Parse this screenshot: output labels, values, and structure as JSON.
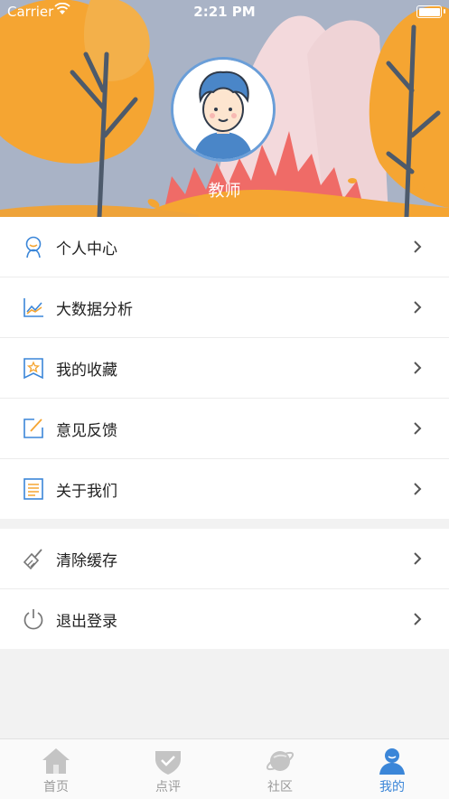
{
  "status_bar": {
    "carrier": "Carrier",
    "time": "2:21 PM"
  },
  "profile": {
    "role": "教师"
  },
  "menu_primary": [
    {
      "label": "个人中心",
      "icon": "user-icon"
    },
    {
      "label": "大数据分析",
      "icon": "chart-icon"
    },
    {
      "label": "我的收藏",
      "icon": "star-bookmark-icon"
    },
    {
      "label": "意见反馈",
      "icon": "edit-icon"
    },
    {
      "label": "关于我们",
      "icon": "document-icon"
    }
  ],
  "menu_secondary": [
    {
      "label": "清除缓存",
      "icon": "broom-icon"
    },
    {
      "label": "退出登录",
      "icon": "power-icon"
    }
  ],
  "tabbar": [
    {
      "label": "首页",
      "icon": "home-icon",
      "active": false
    },
    {
      "label": "点评",
      "icon": "check-shield-icon",
      "active": false
    },
    {
      "label": "社区",
      "icon": "planet-icon",
      "active": false
    },
    {
      "label": "我的",
      "icon": "profile-icon",
      "active": true
    }
  ],
  "colors": {
    "accent": "#3b86d8",
    "orange": "#f5a532",
    "header_bg": "#a9b3c6"
  }
}
